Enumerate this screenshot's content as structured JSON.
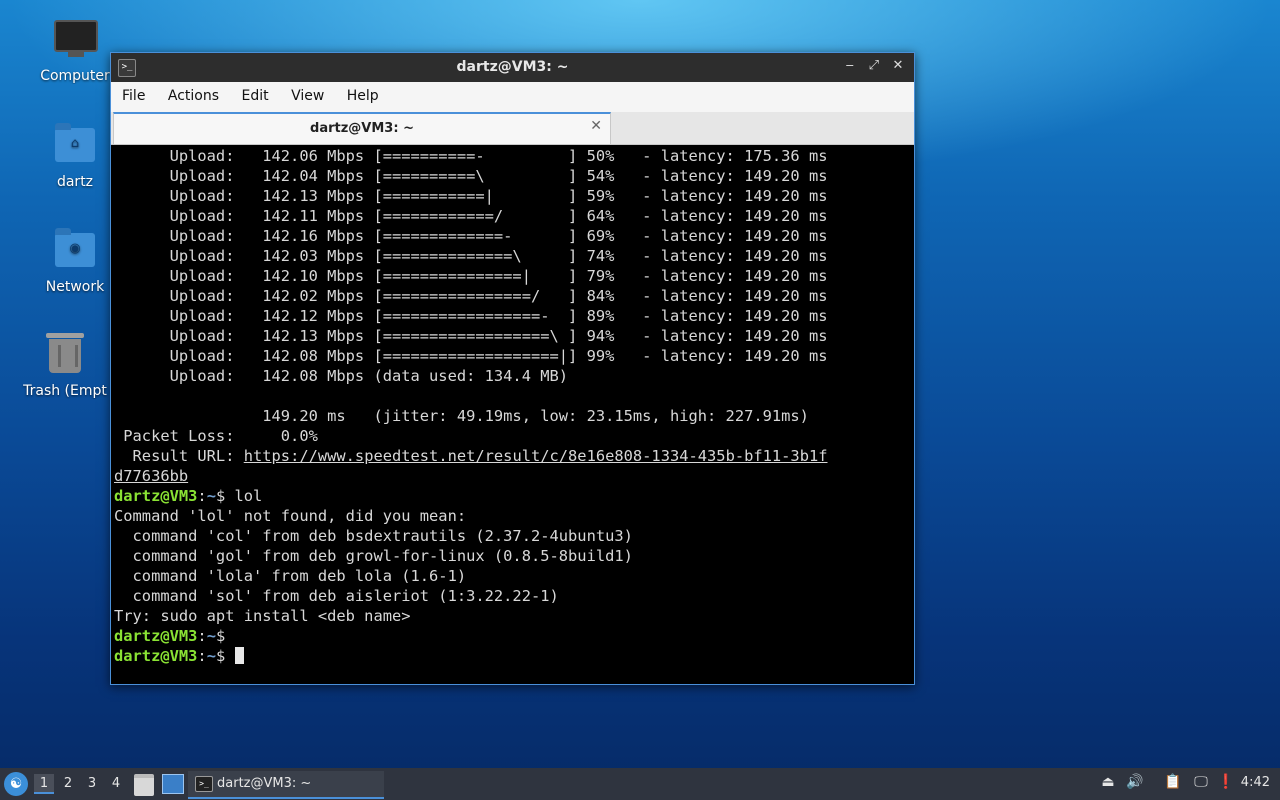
{
  "desktop": {
    "icons": [
      {
        "label": "Computer"
      },
      {
        "label": "dartz"
      },
      {
        "label": "Network"
      },
      {
        "label": "Trash (Empt"
      }
    ]
  },
  "window": {
    "title": "dartz@VM3: ~",
    "controls": {
      "minimize": "‒",
      "maximize": "⤢",
      "close": "✕"
    },
    "menu": [
      "File",
      "Actions",
      "Edit",
      "View",
      "Help"
    ],
    "tab": {
      "label": "dartz@VM3: ~",
      "close": "✕"
    }
  },
  "terminal": {
    "lines": [
      "      Upload:   142.06 Mbps [==========-         ] 50%   - latency: 175.36 ms",
      "      Upload:   142.04 Mbps [==========\\         ] 54%   - latency: 149.20 ms",
      "      Upload:   142.13 Mbps [===========|        ] 59%   - latency: 149.20 ms",
      "      Upload:   142.11 Mbps [============/       ] 64%   - latency: 149.20 ms",
      "      Upload:   142.16 Mbps [=============-      ] 69%   - latency: 149.20 ms",
      "      Upload:   142.03 Mbps [==============\\     ] 74%   - latency: 149.20 ms",
      "      Upload:   142.10 Mbps [===============|    ] 79%   - latency: 149.20 ms",
      "      Upload:   142.02 Mbps [================/   ] 84%   - latency: 149.20 ms",
      "      Upload:   142.12 Mbps [=================-  ] 89%   - latency: 149.20 ms",
      "      Upload:   142.13 Mbps [==================\\ ] 94%   - latency: 149.20 ms",
      "      Upload:   142.08 Mbps [===================|] 99%   - latency: 149.20 ms",
      "      Upload:   142.08 Mbps (data used: 134.4 MB)",
      "",
      "                149.20 ms   (jitter: 49.19ms, low: 23.15ms, high: 227.91ms)",
      " Packet Loss:     0.0%"
    ],
    "result_label": "  Result URL: ",
    "result_url_part1": "https://www.speedtest.net/result/c/8e16e808-1334-435b-bf11-3b1f",
    "result_url_part2": "d77636bb",
    "prompt_user": "dartz@VM3",
    "prompt_sep": ":",
    "prompt_path": "~",
    "prompt_dollar": "$ ",
    "command": "lol",
    "output": [
      "Command 'lol' not found, did you mean:",
      "  command 'col' from deb bsdextrautils (2.37.2-4ubuntu3)",
      "  command 'gol' from deb growl-for-linux (0.8.5-8build1)",
      "  command 'lola' from deb lola (1.6-1)",
      "  command 'sol' from deb aisleriot (1:3.22.22-1)",
      "Try: sudo apt install <deb name>"
    ]
  },
  "taskbar": {
    "start_icon": "☯",
    "workspaces": [
      "1",
      "2",
      "3",
      "4"
    ],
    "task_label": "dartz@VM3: ~",
    "tray_icons": [
      "⏏",
      "🔊",
      "📋",
      "🖵",
      "❗"
    ],
    "clock": "4:42"
  }
}
